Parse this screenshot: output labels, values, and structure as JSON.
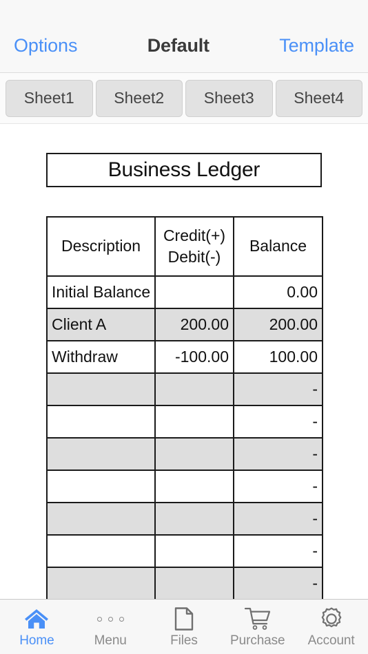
{
  "navbar": {
    "left_button": "Options",
    "title": "Default",
    "right_button": "Template"
  },
  "sheet_tabs": [
    {
      "label": "Sheet1"
    },
    {
      "label": "Sheet2"
    },
    {
      "label": "Sheet3"
    },
    {
      "label": "Sheet4"
    }
  ],
  "document": {
    "title": "Business Ledger",
    "columns": [
      "Description",
      "Credit(+)",
      "Debit(-)",
      "Balance"
    ],
    "header": {
      "description": "Description",
      "credit_line1": "Credit(+)",
      "credit_line2": "Debit(-)",
      "balance": "Balance"
    },
    "rows": [
      {
        "description": "Initial Balance",
        "credit": "",
        "balance": "0.00",
        "shaded": false
      },
      {
        "description": "Client A",
        "credit": "200.00",
        "balance": "200.00",
        "shaded": true
      },
      {
        "description": "Withdraw",
        "credit": "-100.00",
        "balance": "100.00",
        "shaded": false
      },
      {
        "description": "",
        "credit": "",
        "balance": "-",
        "shaded": true
      },
      {
        "description": "",
        "credit": "",
        "balance": "-",
        "shaded": false
      },
      {
        "description": "",
        "credit": "",
        "balance": "-",
        "shaded": true
      },
      {
        "description": "",
        "credit": "",
        "balance": "-",
        "shaded": false
      },
      {
        "description": "",
        "credit": "",
        "balance": "-",
        "shaded": true
      },
      {
        "description": "",
        "credit": "",
        "balance": "-",
        "shaded": false
      },
      {
        "description": "",
        "credit": "",
        "balance": "-",
        "shaded": true
      }
    ]
  },
  "tabbar": {
    "items": [
      {
        "label": "Home",
        "icon": "home-icon",
        "active": true
      },
      {
        "label": "Menu",
        "icon": "more-dots-icon",
        "active": false
      },
      {
        "label": "Files",
        "icon": "document-icon",
        "active": false
      },
      {
        "label": "Purchase",
        "icon": "shopping-cart-icon",
        "active": false
      },
      {
        "label": "Account",
        "icon": "gear-icon",
        "active": false
      }
    ]
  },
  "colors": {
    "accent": "#4a90f7",
    "inactive": "#8a8a8a",
    "row_shade": "#dedede",
    "grid_line": "#1a1a1a",
    "chrome": "#f8f8f8"
  }
}
